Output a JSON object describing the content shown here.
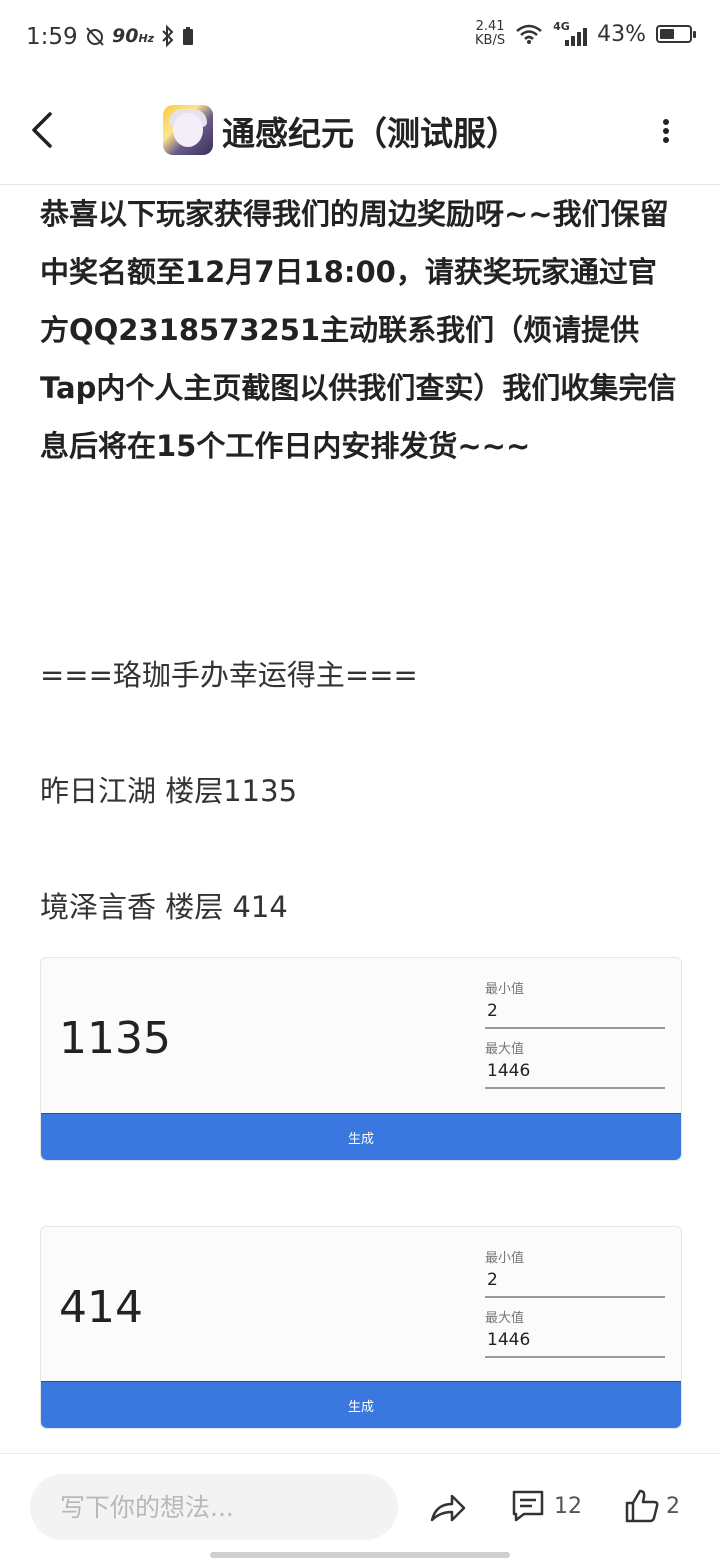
{
  "status_bar": {
    "time": "1:59",
    "refresh_rate": "90",
    "refresh_unit": "Hz",
    "net_speed_value": "2.41",
    "net_speed_unit": "KB/S",
    "network_type": "4G",
    "battery_pct": "43%",
    "battery_level": 0.43
  },
  "header": {
    "title": "通感纪元（测试服）"
  },
  "post": {
    "intro": "恭喜以下玩家获得我们的周边奖励呀~~我们保留中奖名额至12月7日18:00，请获奖玩家通过官方QQ2318573251主动联系我们（烦请提供Tap内个人主页截图以供我们查实）我们收集完信息后将在15个工作日内安排发货~~~",
    "section_heading": "===珞珈手办幸运得主===",
    "winner_1": "昨日江湖 楼层1135",
    "winner_2": "境泽言香 楼层 414"
  },
  "generators": [
    {
      "result": "1135",
      "min_label": "最小值",
      "min_value": "2",
      "max_label": "最大值",
      "max_value": "1446",
      "button_label": "生成"
    },
    {
      "result": "414",
      "min_label": "最小值",
      "min_value": "2",
      "max_label": "最大值",
      "max_value": "1446",
      "button_label": "生成"
    }
  ],
  "bottom_bar": {
    "input_placeholder": "写下你的想法...",
    "comment_count": "12",
    "like_count": "2"
  },
  "colors": {
    "accent_button": "#3a78e0",
    "text": "#222222"
  }
}
